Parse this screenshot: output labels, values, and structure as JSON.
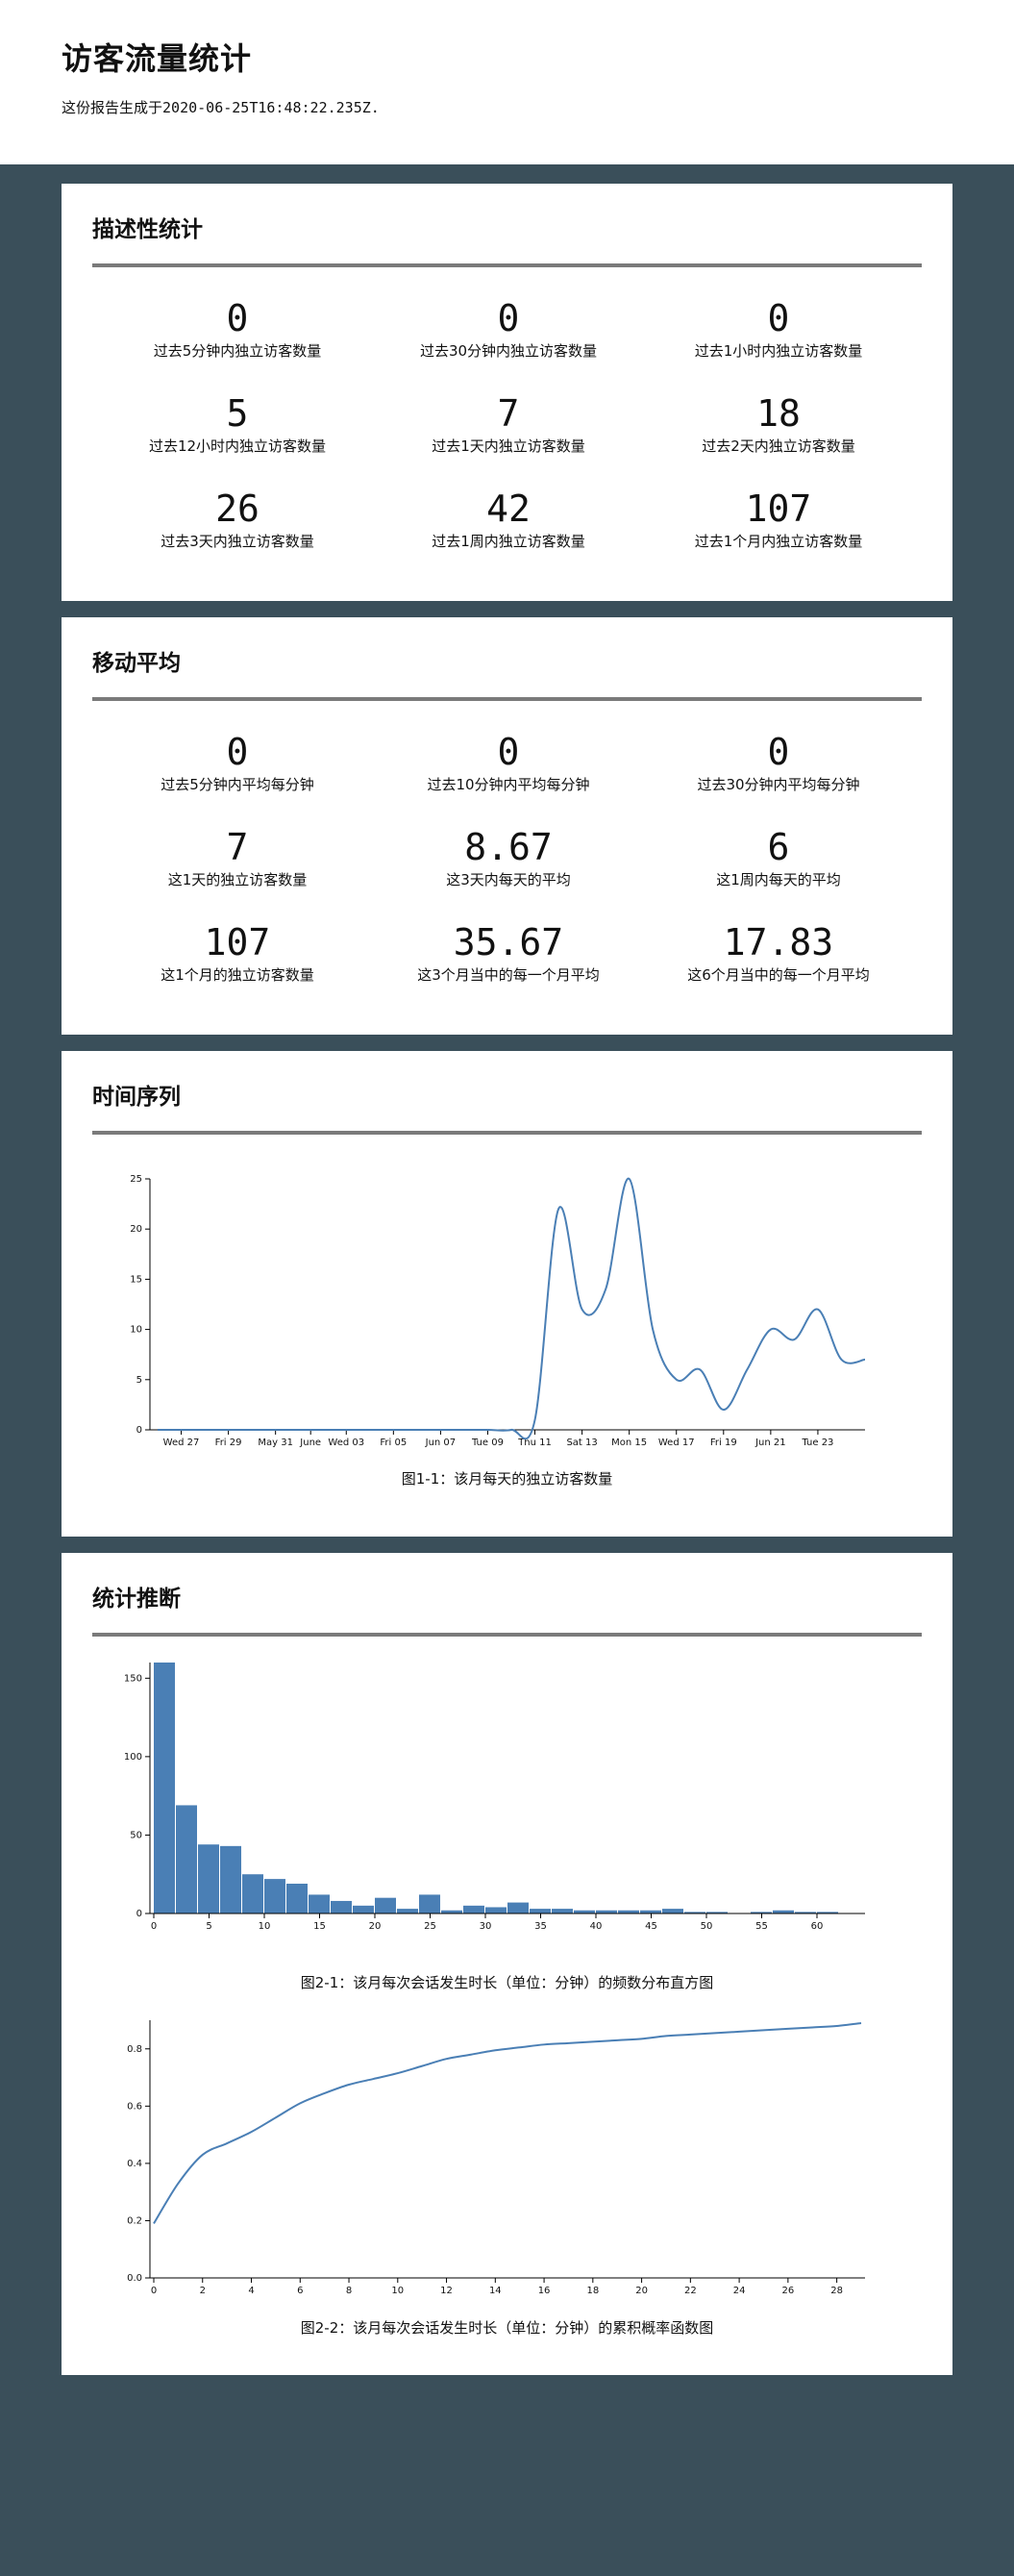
{
  "header": {
    "title": "访客流量统计",
    "generated_prefix": "这份报告生成于",
    "generated_time": "2020-06-25T16:48:22.235Z."
  },
  "descriptive": {
    "title": "描述性统计",
    "stats": [
      {
        "value": "0",
        "label": "过去5分钟内独立访客数量"
      },
      {
        "value": "0",
        "label": "过去30分钟内独立访客数量"
      },
      {
        "value": "0",
        "label": "过去1小时内独立访客数量"
      },
      {
        "value": "5",
        "label": "过去12小时内独立访客数量"
      },
      {
        "value": "7",
        "label": "过去1天内独立访客数量"
      },
      {
        "value": "18",
        "label": "过去2天内独立访客数量"
      },
      {
        "value": "26",
        "label": "过去3天内独立访客数量"
      },
      {
        "value": "42",
        "label": "过去1周内独立访客数量"
      },
      {
        "value": "107",
        "label": "过去1个月内独立访客数量"
      }
    ]
  },
  "moving_avg": {
    "title": "移动平均",
    "stats": [
      {
        "value": "0",
        "label": "过去5分钟内平均每分钟"
      },
      {
        "value": "0",
        "label": "过去10分钟内平均每分钟"
      },
      {
        "value": "0",
        "label": "过去30分钟内平均每分钟"
      },
      {
        "value": "7",
        "label": "这1天的独立访客数量"
      },
      {
        "value": "8.67",
        "label": "这3天内每天的平均"
      },
      {
        "value": "6",
        "label": "这1周内每天的平均"
      },
      {
        "value": "107",
        "label": "这1个月的独立访客数量"
      },
      {
        "value": "35.67",
        "label": "这3个月当中的每一个月平均"
      },
      {
        "value": "17.83",
        "label": "这6个月当中的每一个月平均"
      }
    ]
  },
  "timeseries": {
    "title": "时间序列",
    "caption": "图1-1：该月每天的独立访客数量"
  },
  "inference": {
    "title": "统计推断",
    "caption_hist": "图2-1：该月每次会话发生时长（单位：分钟）的频数分布直方图",
    "caption_cdf": "图2-2：该月每次会话发生时长（单位：分钟）的累积概率函数图"
  },
  "colors": {
    "background": "#3a4f5a",
    "accent": "#4a7fb5",
    "rule": "#7a7a7a"
  },
  "chart_data": [
    {
      "type": "line",
      "xlabel": "",
      "ylabel": "",
      "ylim": [
        0,
        25
      ],
      "y_ticks": [
        0,
        5,
        10,
        15,
        20,
        25
      ],
      "x_tick_labels": [
        "Wed 27",
        "Fri 29",
        "May 31",
        "June",
        "Wed 03",
        "Fri 05",
        "Jun 07",
        "Tue 09",
        "Thu 11",
        "Sat 13",
        "Mon 15",
        "Wed 17",
        "Fri 19",
        "Jun 21",
        "Tue 23"
      ],
      "x": [
        "May 26",
        "May 27",
        "May 28",
        "May 29",
        "May 30",
        "May 31",
        "Jun 01",
        "Jun 02",
        "Jun 03",
        "Jun 04",
        "Jun 05",
        "Jun 06",
        "Jun 07",
        "Jun 08",
        "Jun 09",
        "Jun 10",
        "Jun 11",
        "Jun 12",
        "Jun 13",
        "Jun 14",
        "Jun 15",
        "Jun 16",
        "Jun 17",
        "Jun 18",
        "Jun 19",
        "Jun 20",
        "Jun 21",
        "Jun 22",
        "Jun 23",
        "Jun 24",
        "Jun 25"
      ],
      "values": [
        0,
        0,
        0,
        0,
        0,
        0,
        0,
        0,
        0,
        0,
        0,
        0,
        0,
        0,
        0,
        0,
        1,
        22,
        12,
        14,
        25,
        10,
        5,
        6,
        2,
        6,
        10,
        9,
        12,
        7,
        7
      ]
    },
    {
      "type": "bar",
      "xlabel": "",
      "ylabel": "",
      "xlim": [
        0,
        64
      ],
      "ylim": [
        0,
        160
      ],
      "x_ticks": [
        0,
        5,
        10,
        15,
        20,
        25,
        30,
        35,
        40,
        45,
        50,
        55,
        60
      ],
      "y_ticks": [
        0,
        50,
        100,
        150
      ],
      "bin_width": 2,
      "values": [
        160,
        69,
        44,
        43,
        25,
        22,
        19,
        12,
        8,
        5,
        10,
        3,
        12,
        2,
        5,
        4,
        7,
        3,
        3,
        2,
        2,
        2,
        2,
        3,
        1,
        1,
        0,
        1,
        2,
        1,
        1,
        0
      ]
    },
    {
      "type": "line",
      "xlabel": "",
      "ylabel": "",
      "xlim": [
        0,
        29
      ],
      "ylim": [
        0,
        0.9
      ],
      "x_ticks": [
        0,
        2,
        4,
        6,
        8,
        10,
        12,
        14,
        16,
        18,
        20,
        22,
        24,
        26,
        28
      ],
      "y_ticks": [
        0.0,
        0.2,
        0.4,
        0.6,
        0.8
      ],
      "x": [
        0,
        1,
        2,
        3,
        4,
        5,
        6,
        7,
        8,
        9,
        10,
        11,
        12,
        13,
        14,
        15,
        16,
        17,
        18,
        19,
        20,
        21,
        22,
        23,
        24,
        25,
        26,
        27,
        28,
        29
      ],
      "values": [
        0.19,
        0.33,
        0.43,
        0.47,
        0.51,
        0.56,
        0.61,
        0.645,
        0.675,
        0.695,
        0.715,
        0.74,
        0.765,
        0.78,
        0.795,
        0.805,
        0.815,
        0.82,
        0.825,
        0.83,
        0.835,
        0.845,
        0.85,
        0.855,
        0.86,
        0.865,
        0.87,
        0.875,
        0.88,
        0.89
      ]
    }
  ]
}
